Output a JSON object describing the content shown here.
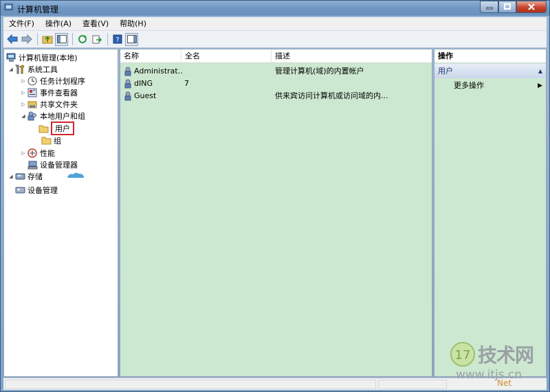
{
  "window": {
    "title": "计算机管理"
  },
  "menu": {
    "items": [
      "文件(F)",
      "操作(A)",
      "查看(V)",
      "帮助(H)"
    ]
  },
  "toolbar": {
    "buttons": [
      "back-icon",
      "forward-icon",
      "up-folder-icon",
      "show-tree-icon",
      "refresh-icon",
      "export-icon",
      "help-icon",
      "show-action-pane-icon"
    ]
  },
  "tree": {
    "root": "计算机管理(本地)",
    "system_tools": "系统工具",
    "task_scheduler": "任务计划程序",
    "event_viewer": "事件查看器",
    "shared_folders": "共享文件夹",
    "local_users_groups": "本地用户和组",
    "users": "用户",
    "groups": "组",
    "performance": "性能",
    "device_manager": "设备管理器",
    "storage": "存储",
    "disk_management": "设备管理"
  },
  "list": {
    "columns": [
      "名称",
      "全名",
      "描述"
    ],
    "rows": [
      {
        "name": "Administrat...",
        "fullname": "",
        "description": "管理计算机(域)的内置帐户"
      },
      {
        "name": "dING",
        "fullname": "7",
        "description": ""
      },
      {
        "name": "Guest",
        "fullname": "",
        "description": "供来宾访问计算机或访问域的内..."
      }
    ]
  },
  "actions": {
    "header": "操作",
    "group": "用户",
    "more": "更多操作"
  },
  "watermark": {
    "brand": "技术网",
    "url": "www.itjs.cn",
    "mark": "Net"
  },
  "colors": {
    "pane_bg": "#cde8d0",
    "selection_border": "#d0272c",
    "title_bar": "#7fa3c9"
  }
}
